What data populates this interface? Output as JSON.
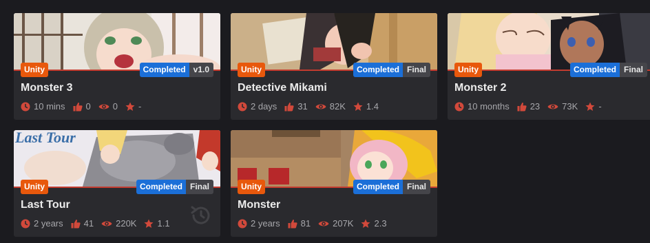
{
  "cards": [
    {
      "title": "Monster 3",
      "engine": "Unity",
      "status": "Completed",
      "version": "v1.0",
      "updated": "10 mins",
      "likes": "0",
      "views": "0",
      "rating": "-"
    },
    {
      "title": "Detective Mikami",
      "engine": "Unity",
      "status": "Completed",
      "version": "Final",
      "updated": "2 days",
      "likes": "31",
      "views": "82K",
      "rating": "1.4"
    },
    {
      "title": "Monster 2",
      "engine": "Unity",
      "status": "Completed",
      "version": "Final",
      "updated": "10 months",
      "likes": "23",
      "views": "73K",
      "rating": "-"
    },
    {
      "title": "Last Tour",
      "engine": "Unity",
      "status": "Completed",
      "version": "Final",
      "updated": "2 years",
      "likes": "41",
      "views": "220K",
      "rating": "1.1",
      "thumb_text": "Last Tour"
    },
    {
      "title": "Monster",
      "engine": "Unity",
      "status": "Completed",
      "version": "Final",
      "updated": "2 years",
      "likes": "81",
      "views": "207K",
      "rating": "2.3"
    }
  ],
  "icons": {
    "clock": "clock-icon",
    "like": "thumbs-up-icon",
    "views": "eye-icon",
    "rating": "star-icon",
    "history": "history-icon"
  },
  "colors": {
    "background": "#1b1b1f",
    "card": "#2a2a2e",
    "engine_badge": "#e8580c",
    "status_badge": "#1b6fd8",
    "version_badge": "#45454a",
    "icon_accent": "#d2493b"
  }
}
